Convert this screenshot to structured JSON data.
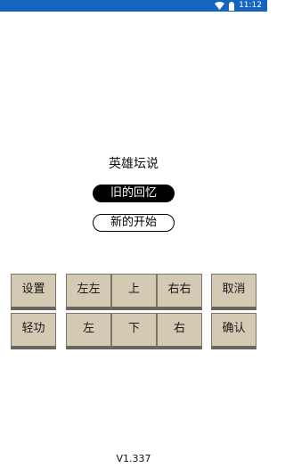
{
  "status_bar": {
    "time": "11:12",
    "wifi_icon": "wifi-icon",
    "battery_icon": "battery-icon"
  },
  "title": "英雄坛说",
  "menu": {
    "continue_label": "旧的回忆",
    "new_game_label": "新的开始"
  },
  "keys": {
    "settings": "设置",
    "left_left": "左左",
    "up": "上",
    "right_right": "右右",
    "cancel": "取消",
    "qinggong": "轻功",
    "left": "左",
    "down": "下",
    "right": "右",
    "confirm": "确认"
  },
  "version": "V1.337",
  "colors": {
    "status_bar": "#1565c0",
    "key_face": "#d4c9b2",
    "key_shadow": "#6a655c"
  }
}
